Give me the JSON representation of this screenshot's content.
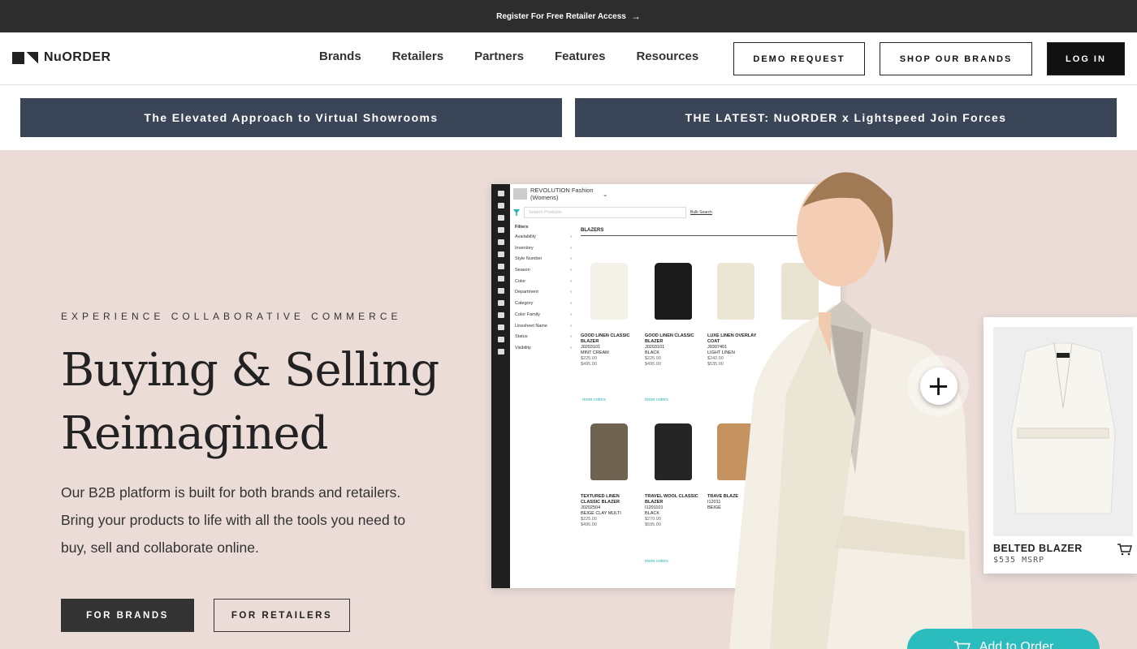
{
  "topbar": {
    "text": "Register For Free Retailer Access",
    "arrow": "→"
  },
  "nav": {
    "logo": "NuORDER",
    "menu": [
      "Brands",
      "Retailers",
      "Partners",
      "Features",
      "Resources"
    ],
    "demo": "DEMO REQUEST",
    "shop": "SHOP OUR BRANDS",
    "login": "LOG IN"
  },
  "promos": [
    "The Elevated Approach to Virtual Showrooms",
    "THE LATEST: NuORDER x Lightspeed Join Forces"
  ],
  "hero": {
    "eyebrow": "EXPERIENCE COLLABORATIVE COMMERCE",
    "title_line1": "Buying & Selling",
    "title_line2": "Reimagined",
    "desc": "Our B2B platform is built for both brands and retailers. Bring your products to life with all the tools you need to buy, sell and collaborate online.",
    "cta_brands": "FOR BRANDS",
    "cta_retailers": "FOR RETAILERS"
  },
  "app": {
    "store": "REVOLUTION Fashion (Womens)",
    "search_placeholder": "Search Products",
    "bulk": "Bulk Search",
    "filters_title": "Filters",
    "filters": [
      "Availability",
      "Inventory",
      "Style Number",
      "Season",
      "Color",
      "Department",
      "Category",
      "Color Family",
      "Linesheet Name",
      "Status",
      "Visibility"
    ],
    "category": "BLAZERS",
    "more_colors": "more colors",
    "products": [
      {
        "name": "GOOD LINEN CLASSIC BLAZER",
        "sku": "J0203101",
        "color": "MINT CREAM",
        "wholesale": "$225.00",
        "msrp": "$495.00",
        "fill": "#f4f1e8"
      },
      {
        "name": "GOOD LINEN CLASSIC BLAZER",
        "sku": "J0203101",
        "color": "BLACK",
        "wholesale": "$225.00",
        "msrp": "$495.00",
        "fill": "#1b1b1b"
      },
      {
        "name": "LUXE LINEN OVERLAY COAT",
        "sku": "J0307401",
        "color": "LIGHT LINEN",
        "wholesale": "$242.00",
        "msrp": "$535.00",
        "fill": "#ece6d4"
      },
      {
        "name": "",
        "sku": "",
        "color": "",
        "wholesale": "",
        "msrp": "",
        "fill": "#e9e4d2"
      },
      {
        "name": "TEXTURED LINEN CLASSIC BLAZER",
        "sku": "J0202504",
        "color": "BEIGE CLAY MULTI",
        "wholesale": "$225.00",
        "msrp": "$495.00",
        "fill": "#6d6350"
      },
      {
        "name": "TRAVEL WOOL CLASSIC BLAZER",
        "sku": "I1201101",
        "color": "BLACK",
        "wholesale": "$270.00",
        "msrp": "$595.00",
        "fill": "#252525"
      },
      {
        "name": "TRAVE BLAZE",
        "sku": "I12011",
        "color": "BEIGE",
        "wholesale": "",
        "msrp": "",
        "fill": "#c4935f"
      }
    ]
  },
  "card": {
    "name": "BELTED BLAZER",
    "price": "$535 MSRP"
  },
  "add_to_order": "Add to Order",
  "colors": {
    "topbar": "#2d2d2d",
    "promo": "#3b4558",
    "hero_bg": "#ebdcd8",
    "teal": "#2bbdbd"
  }
}
